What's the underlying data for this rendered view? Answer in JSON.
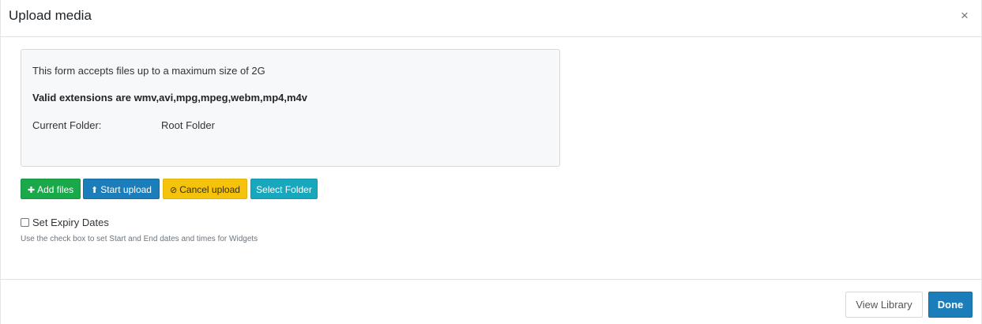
{
  "header": {
    "title": "Upload media",
    "close_symbol": "×"
  },
  "info": {
    "max_size_text": "This form accepts files up to a maximum size of 2G",
    "extensions_text": "Valid extensions are wmv,avi,mpg,mpeg,webm,mp4,m4v",
    "folder_label": "Current Folder:",
    "folder_value": "Root Folder"
  },
  "actions": {
    "add_files": {
      "label": "Add files",
      "icon": "plus-icon",
      "glyph": "✚",
      "color": "#1aa94a"
    },
    "start_upload": {
      "label": "Start upload",
      "icon": "upload-icon",
      "glyph": "⬆",
      "color": "#1b7dba"
    },
    "cancel_upload": {
      "label": "Cancel upload",
      "icon": "ban-icon",
      "glyph": "⊘",
      "color": "#f5c30b"
    },
    "select_folder": {
      "label": "Select Folder",
      "color": "#17a8bd"
    }
  },
  "expiry": {
    "label": "Set Expiry Dates",
    "checked": false,
    "help": "Use the check box to set Start and End dates and times for Widgets"
  },
  "footer": {
    "view_library": "View Library",
    "done": "Done",
    "accent": "#1b7dba"
  }
}
